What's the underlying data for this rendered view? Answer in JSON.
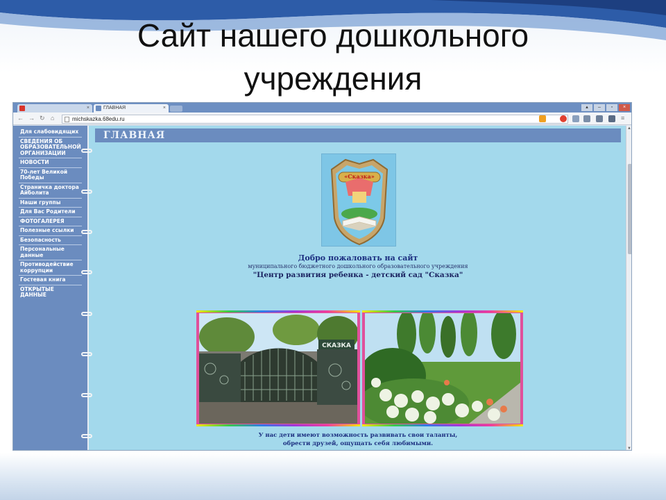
{
  "slide": {
    "title_line1": "Сайт нашего дошкольного",
    "title_line2": "учреждения"
  },
  "browser": {
    "tabs": [
      {
        "label": "",
        "favicon_color": "#d9342b"
      },
      {
        "label": "ГЛАВНАЯ",
        "favicon_color": "#6b8cbf"
      }
    ],
    "address": "michskazka.68edu.ru"
  },
  "site": {
    "menu": [
      "Для слабовидящих",
      "СВЕДЕНИЯ ОБ ОБРАЗОВАТЕЛЬНОЙ ОРГАНИЗАЦИИ",
      "НОВОСТИ",
      "70-лет Великой Победы",
      "Страничка доктора Айболита",
      "Наши группы",
      "Для Вас Родители",
      "ФОТОГАЛЕРЕЯ",
      "Полезные ссылки",
      "Безопасность",
      "Персональные данные",
      "Противодействие коррупции",
      "Гостевая книга",
      "ОТКРЫТЫЕ ДАННЫЕ"
    ],
    "header_title": "ГЛАВНАЯ",
    "logo_text": "«Сказка»",
    "welcome_line1": "Добро пожаловать на сайт",
    "welcome_line2": "муниципального бюджетного дошкольного образовательного учреждения",
    "welcome_line3": "\"Центр развития ребенка - детский сад \"Сказка\"",
    "photo_sign": "СКАЗКА",
    "caption_line1": "У нас дети имеют возможность развивать свои таланты,",
    "caption_line2": "обрести друзей, ощущать себя любимыми."
  },
  "colors": {
    "page_bg": "#a3d9ec",
    "sidebar_bg": "#6b8cbf",
    "photo_frame": "#e0509b"
  }
}
